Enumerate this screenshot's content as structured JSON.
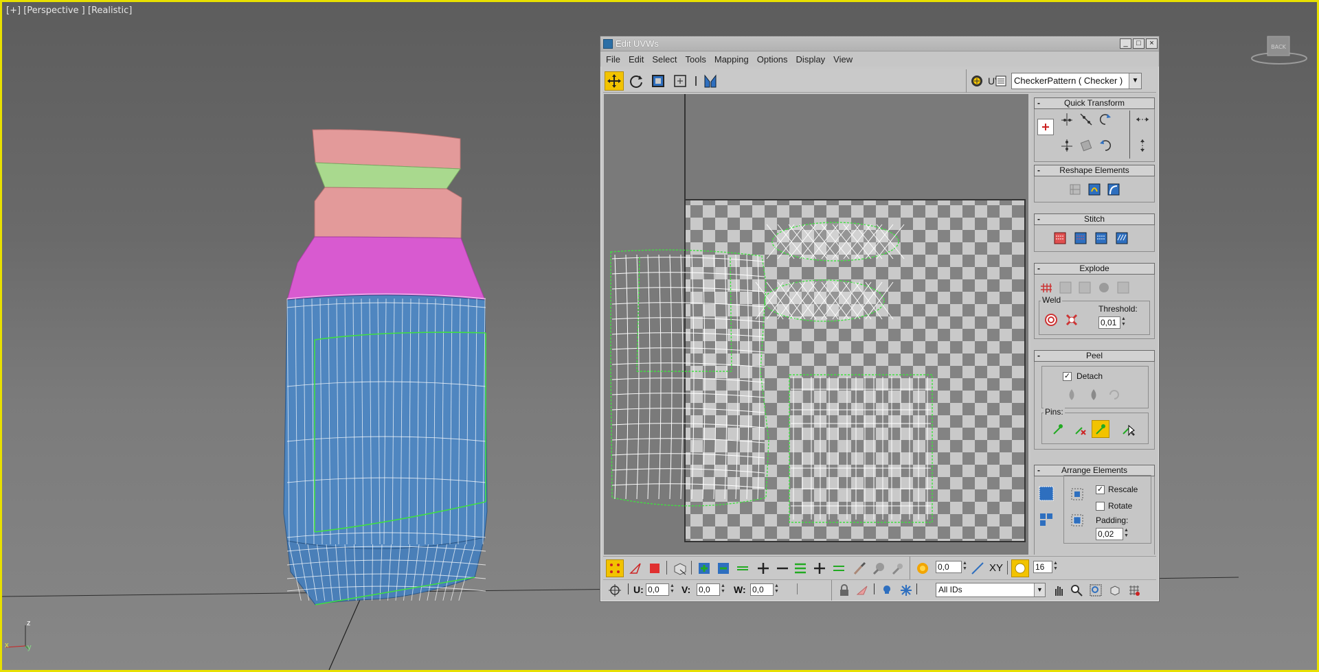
{
  "viewport": {
    "label_plus": "[+]",
    "label_view": "[Perspective ]",
    "label_shading": "[Realistic]",
    "viewcube_label": "BACK",
    "axis_x": "x",
    "axis_y": "y",
    "axis_z": "z"
  },
  "uvw_window": {
    "title": "Edit UVWs",
    "buttons": {
      "minimize": "_",
      "maximize": "□",
      "close": "×"
    },
    "menu": [
      "File",
      "Edit",
      "Select",
      "Tools",
      "Mapping",
      "Options",
      "Display",
      "View"
    ],
    "toolbar": {
      "uv_label": "UV",
      "texture_select": "CheckerPattern  ( Checker )"
    },
    "rollouts": {
      "quick_transform": "Quick Transform",
      "reshape_elements": "Reshape Elements",
      "stitch": "Stitch",
      "explode": "Explode",
      "weld_label": "Weld",
      "threshold_label": "Threshold:",
      "threshold_value": "0,01",
      "peel": "Peel",
      "detach_label": "Detach",
      "detach_checked": "✓",
      "pins_label": "Pins:",
      "arrange_elements": "Arrange Elements",
      "rescale_label": "Rescale",
      "rescale_checked": "✓",
      "rotate_label": "Rotate",
      "padding_label": "Padding:",
      "padding_value": "0,02",
      "collapse": "-"
    },
    "bottom_bar": {
      "soft_value": "0,0",
      "xy_label": "XY",
      "grid_value": "16",
      "u_label": "U:",
      "u_value": "0,0",
      "v_label": "V:",
      "v_value": "0,0",
      "w_label": "W:",
      "w_value": "0,0",
      "ids_select": "All IDs"
    }
  },
  "colors": {
    "frame": "#e8e000",
    "mesh_blue": "#4f86c0",
    "mesh_pink": "#e39393",
    "mesh_green": "#a9d98e",
    "mesh_magenta": "#d85ad0",
    "seam_green": "#40e040",
    "highlight": "#f2c300"
  }
}
